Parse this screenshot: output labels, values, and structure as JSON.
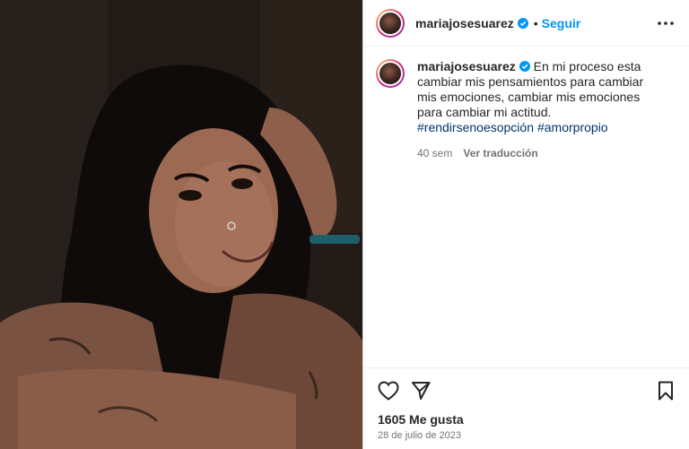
{
  "post": {
    "username": "mariajosesuarez",
    "follow_label": "Seguir",
    "caption_text": "En mi proceso esta cambiar mis pensamientos para cambiar mis emociones, cambiar mis emociones para cambiar mi actitud.",
    "hashtags": [
      "#rendirsenoesopción",
      "#amorpropio"
    ],
    "time_ago": "40 sem",
    "translate_label": "Ver traducción",
    "likes": "1605 Me gusta",
    "date": "28 de julio de 2023"
  },
  "icons": {
    "verified": "verified-badge-icon",
    "more": "more-options-icon",
    "like": "heart-icon",
    "share": "send-icon",
    "save": "bookmark-icon"
  },
  "colors": {
    "accent": "#0095f6",
    "hashtag": "#00376b",
    "muted": "#737373",
    "text": "#262626"
  }
}
